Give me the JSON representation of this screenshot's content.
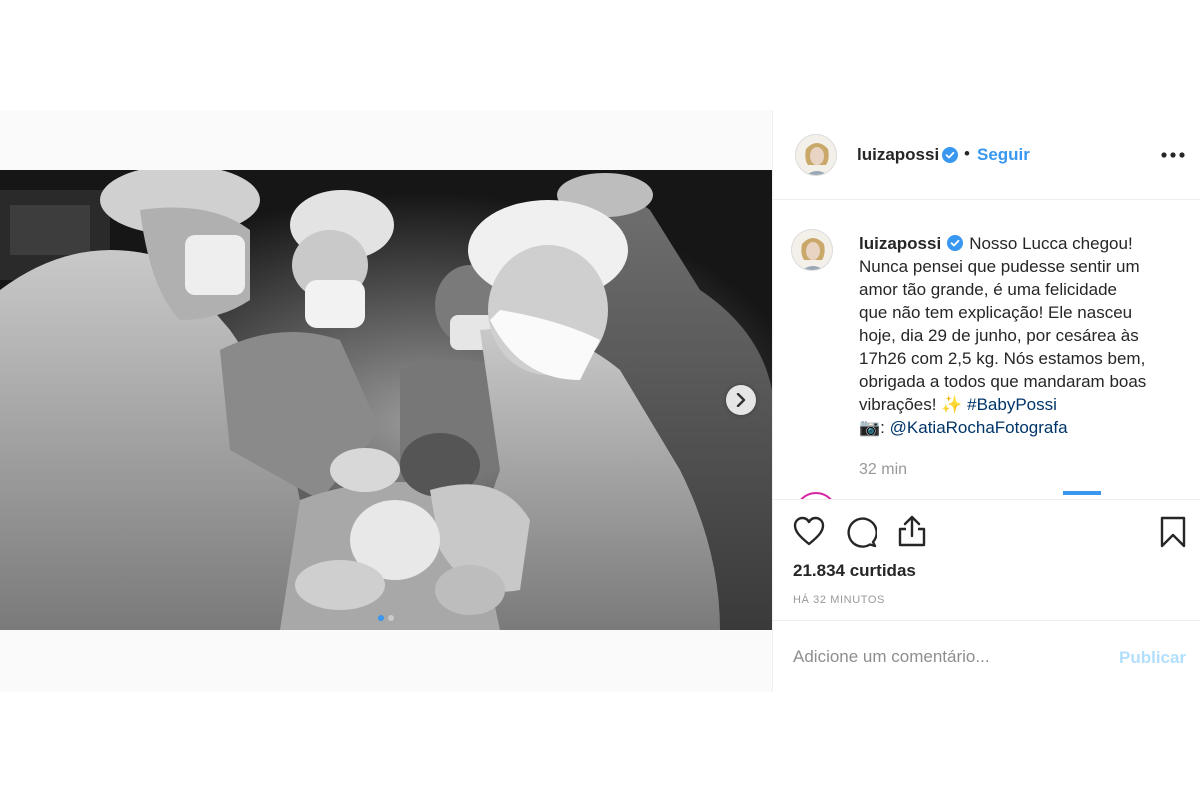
{
  "post": {
    "author": {
      "username": "luizapossi",
      "verified": true,
      "avatar_icon": "avatar-photo"
    },
    "header": {
      "separator": "•",
      "follow_label": "Seguir",
      "more_icon": "more-horizontal-icon"
    },
    "caption": {
      "username": "luizapossi",
      "lines": [
        "Nosso Lucca chegou!",
        "Nunca pensei que pudesse sentir um",
        "amor tão grande, é uma felicidade",
        "que não tem explicação! Ele nasceu",
        "hoje, dia 29 de junho, por cesárea às",
        "17h26 com 2,5 kg. Nós estamos bem,",
        "obrigada a todos que mandaram boas"
      ],
      "last_line_text": "vibrações!",
      "sparkle_emoji": "✨",
      "hashtag": "#BabyPossi",
      "camera_emoji": "📷",
      "credit_sep": ":",
      "mention": "@KatiaRochaFotografa",
      "time": "32 min"
    },
    "actions": {
      "like_icon": "heart-icon",
      "comment_icon": "comment-bubble-icon",
      "share_icon": "share-icon",
      "save_icon": "bookmark-icon"
    },
    "likes_label": "21.834 curtidas",
    "posted_ago": "HÁ 32 MINUTOS",
    "comment_box": {
      "placeholder": "Adicione um comentário...",
      "value": "",
      "publish_label": "Publicar"
    },
    "carousel": {
      "current": 1,
      "total": 2,
      "next_icon": "chevron-right-icon"
    },
    "colors": {
      "link_blue": "#3897f0",
      "hashtag_blue": "#003569",
      "publish_disabled": "#b2dffc",
      "muted_grey": "#999999"
    }
  }
}
